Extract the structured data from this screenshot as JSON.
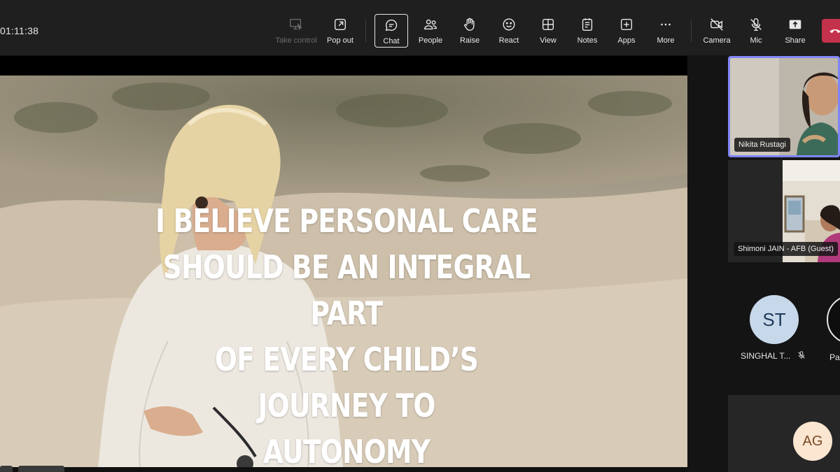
{
  "toolbar": {
    "timer": "01:11:38",
    "buttons": {
      "take_control": "Take control",
      "pop_out": "Pop out",
      "chat": "Chat",
      "people": "People",
      "raise": "Raise",
      "react": "React",
      "view": "View",
      "notes": "Notes",
      "apps": "Apps",
      "more": "More",
      "camera": "Camera",
      "mic": "Mic",
      "share": "Share"
    },
    "icons": {
      "take_control": "take-control-icon",
      "pop_out": "pop-out-icon",
      "chat": "chat-bubble-icon",
      "people": "people-icon",
      "raise": "hand-icon",
      "react": "smiley-icon",
      "view": "grid-icon",
      "notes": "notes-icon",
      "apps": "plus-icon",
      "more": "ellipsis-icon",
      "camera": "camera-off-icon",
      "mic": "mic-off-icon",
      "share": "share-icon",
      "leave": "phone-hangup-icon"
    },
    "colors": {
      "leave_bg": "#c4314b",
      "active_speaker_border": "#7f85f5"
    }
  },
  "slide": {
    "quote_lines": [
      "I BELIEVE PERSONAL CARE",
      "SHOULD BE AN INTEGRAL PART",
      "OF EVERY CHILD’S JOURNEY TO",
      "AUTONOMY"
    ]
  },
  "participants": {
    "tile1": {
      "name": "Nikita Rustagi"
    },
    "tile2": {
      "name": "Shimoni JAIN - AFB (Guest)"
    },
    "tile3": {
      "initials": "ST",
      "name": "SINGHAL T...",
      "second_name": "Pa"
    },
    "tile4": {
      "initials": "AG"
    }
  }
}
